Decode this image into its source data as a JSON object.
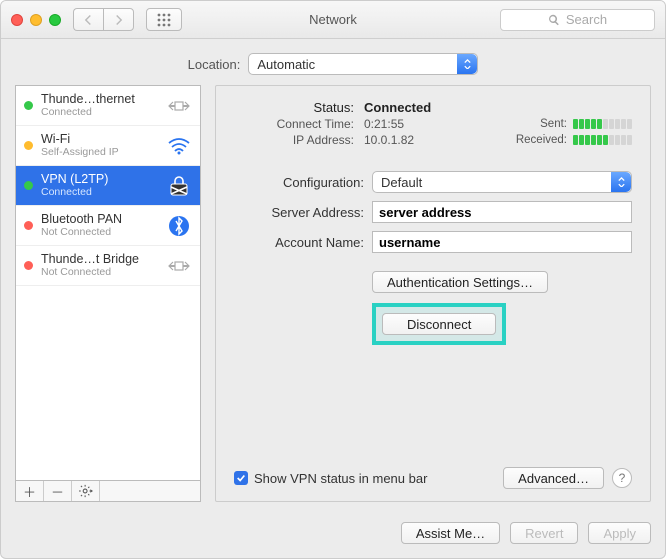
{
  "window_title": "Network",
  "search_placeholder": "Search",
  "location": {
    "label": "Location:",
    "value": "Automatic"
  },
  "sidebar": {
    "items": [
      {
        "name": "Thunde…thernet",
        "sub": "Connected",
        "status": "green",
        "icon": "ethernet"
      },
      {
        "name": "Wi-Fi",
        "sub": "Self-Assigned IP",
        "status": "yellow",
        "icon": "wifi"
      },
      {
        "name": "VPN (L2TP)",
        "sub": "Connected",
        "status": "green",
        "icon": "vpn",
        "selected": true
      },
      {
        "name": "Bluetooth PAN",
        "sub": "Not Connected",
        "status": "red",
        "icon": "bluetooth"
      },
      {
        "name": "Thunde…t Bridge",
        "sub": "Not Connected",
        "status": "red",
        "icon": "ethernet"
      }
    ]
  },
  "status": {
    "label": "Status:",
    "value": "Connected",
    "connect_time_label": "Connect Time:",
    "connect_time": "0:21:55",
    "ip_label": "IP Address:",
    "ip": "10.0.1.82",
    "sent_label": "Sent:",
    "sent_bars": 5,
    "recv_label": "Received:",
    "recv_bars": 6
  },
  "form": {
    "config_label": "Configuration:",
    "config_value": "Default",
    "server_label": "Server Address:",
    "server_value": "server address",
    "acct_label": "Account Name:",
    "acct_value": "username"
  },
  "actions": {
    "auth_settings": "Authentication Settings…",
    "disconnect": "Disconnect"
  },
  "show_vpn_label": "Show VPN status in menu bar",
  "advanced_label": "Advanced…",
  "footer": {
    "assist": "Assist Me…",
    "revert": "Revert",
    "apply": "Apply"
  }
}
